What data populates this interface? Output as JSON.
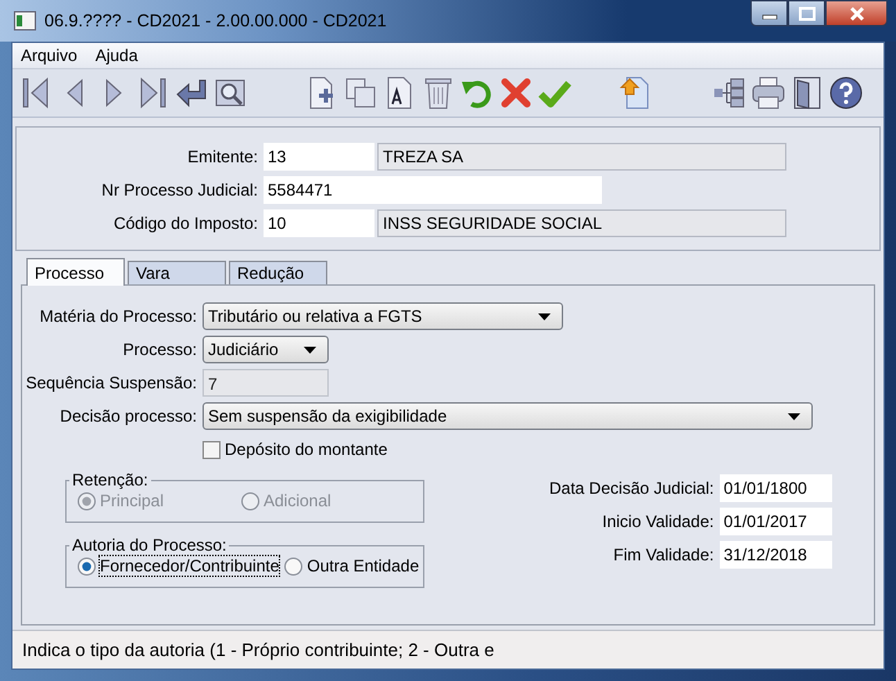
{
  "window": {
    "title": "06.9.???? - CD2021 - 2.00.00.000 - CD2021"
  },
  "menu": [
    "Arquivo",
    "Ajuda"
  ],
  "header_fields": [
    {
      "label": "Emitente:",
      "value": "13",
      "description": "TREZA SA"
    },
    {
      "label": "Nr Processo Judicial:",
      "value": "5584471"
    },
    {
      "label": "Código do Imposto:",
      "value": "10",
      "description": "INSS SEGURIDADE SOCIAL"
    }
  ],
  "tabs": [
    {
      "label": "Processo",
      "selected": true
    },
    {
      "label": "Vara",
      "selected": false
    },
    {
      "label": "Redução",
      "selected": false
    }
  ],
  "form": {
    "materia_do_processo": {
      "label": "Matéria do Processo:",
      "value": "Tributário ou relativa a FGTS"
    },
    "processo": {
      "label": "Processo:",
      "value": "Judiciário"
    },
    "sequencia_suspensao": {
      "label": "Sequência Suspensão:",
      "value": "7",
      "disabled": true
    },
    "decisao_processo": {
      "label": "Decisão processo:",
      "value": "Sem suspensão da exigibilidade"
    },
    "deposito_do_montante": {
      "label": "Depósito do montante",
      "checked": false
    }
  },
  "retencao": {
    "title": "Retenção:",
    "disabled": true,
    "options": [
      {
        "label": "Principal",
        "selected": true,
        "focused": false
      },
      {
        "label": "Adicional",
        "selected": false,
        "focused": false
      }
    ]
  },
  "autoria": {
    "title": "Autoria do Processo:",
    "disabled": false,
    "options": [
      {
        "label": "Fornecedor/Contribuinte",
        "selected": true,
        "focused": true
      },
      {
        "label": "Outra Entidade",
        "selected": false,
        "focused": false
      }
    ]
  },
  "dates": [
    {
      "label": "Data Decisão Judicial:",
      "value": "01/01/1800"
    },
    {
      "label": "Inicio Validade:",
      "value": "01/01/2017"
    },
    {
      "label": "Fim Validade:",
      "value": "31/12/2018"
    }
  ],
  "status_bar": "Indica o tipo da autoria (1 - Próprio contribuinte; 2 - Outra e"
}
